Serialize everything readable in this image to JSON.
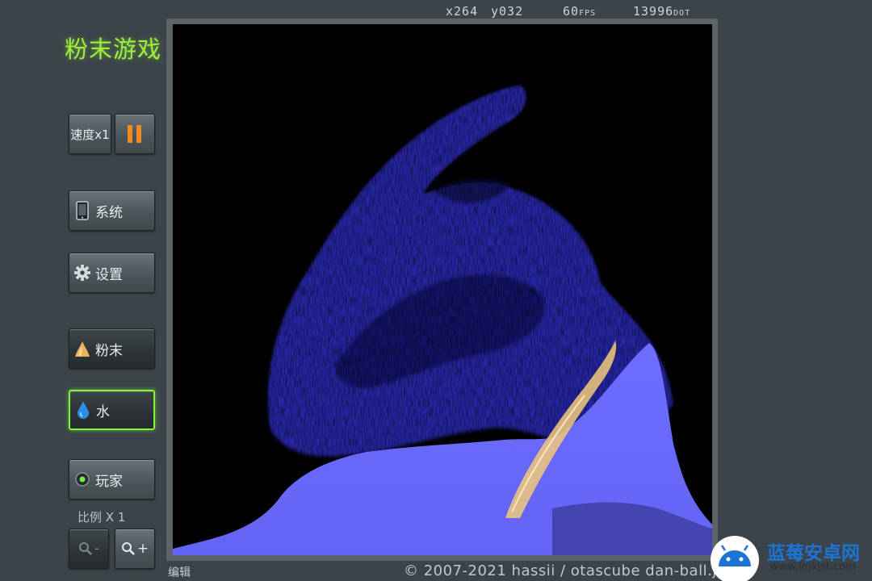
{
  "app": {
    "title": "粉末游戏"
  },
  "status": {
    "x": "x264",
    "y": "y032",
    "fps_value": "60",
    "fps_unit": "FPS",
    "dot_value": "13996",
    "dot_unit": "DOT"
  },
  "controls": {
    "speed_label": "速度x1",
    "pause_icon": "pause-icon",
    "system_label": "系统",
    "settings_label": "设置",
    "powder_label": "粉末",
    "water_label": "水",
    "player_label": "玩家",
    "scale_label": "比例 X 1",
    "zoom_out_label": "-",
    "zoom_in_label": "+"
  },
  "selected_element": "水",
  "footer": {
    "edit_label": "编辑",
    "copyright": "© 2007-2021 hassii / otascube  dan-ball.jp"
  },
  "watermark": {
    "brand": "蓝莓安卓网",
    "url": "www.lmkjst.com"
  },
  "colors": {
    "accent_green": "#7cf53a",
    "water_blue": "#6a6aff",
    "pause_orange": "#f08a1c",
    "canvas_bg": "#000000"
  }
}
